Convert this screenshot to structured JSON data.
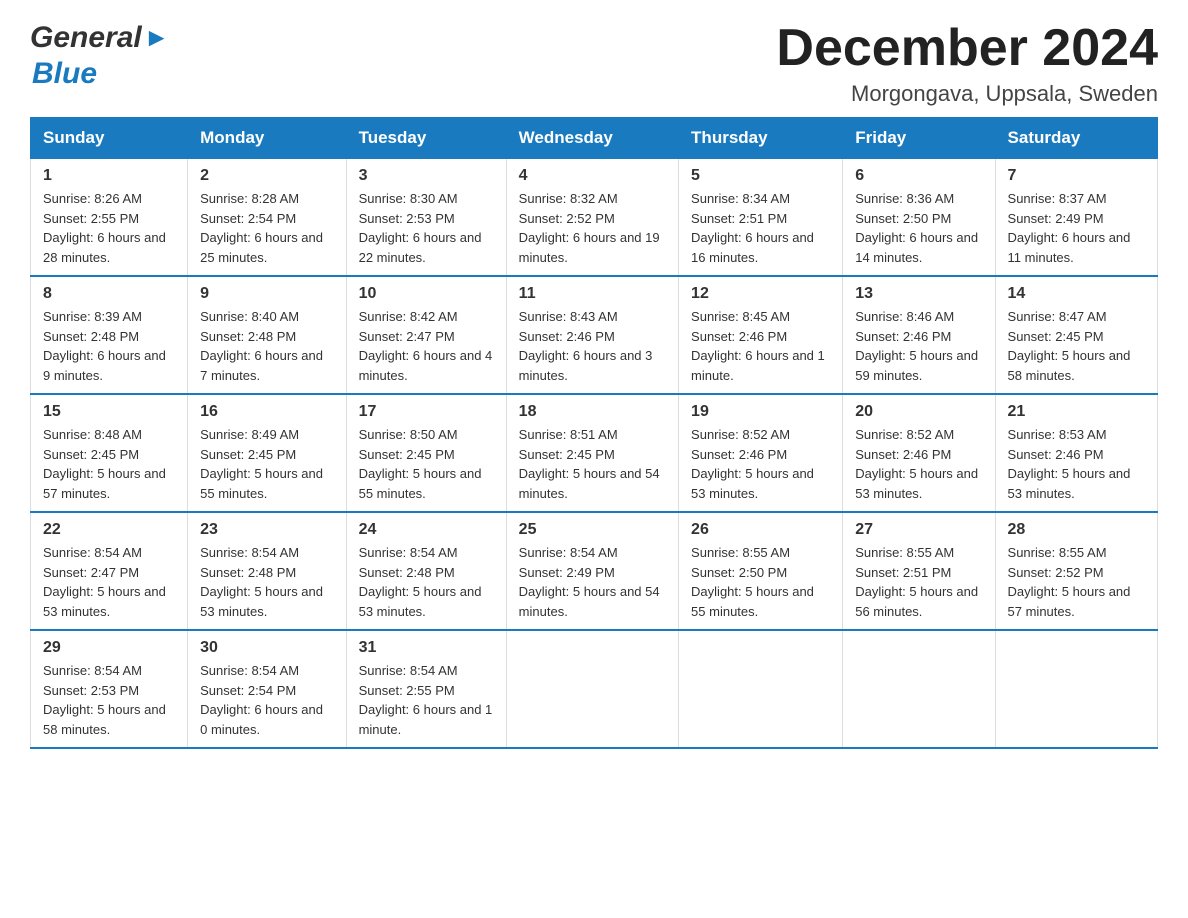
{
  "header": {
    "title": "December 2024",
    "subtitle": "Morgongava, Uppsala, Sweden"
  },
  "logo": {
    "line1": "General",
    "line2": "Blue"
  },
  "days_of_week": [
    "Sunday",
    "Monday",
    "Tuesday",
    "Wednesday",
    "Thursday",
    "Friday",
    "Saturday"
  ],
  "weeks": [
    [
      {
        "day": "1",
        "sunrise": "8:26 AM",
        "sunset": "2:55 PM",
        "daylight": "6 hours and 28 minutes."
      },
      {
        "day": "2",
        "sunrise": "8:28 AM",
        "sunset": "2:54 PM",
        "daylight": "6 hours and 25 minutes."
      },
      {
        "day": "3",
        "sunrise": "8:30 AM",
        "sunset": "2:53 PM",
        "daylight": "6 hours and 22 minutes."
      },
      {
        "day": "4",
        "sunrise": "8:32 AM",
        "sunset": "2:52 PM",
        "daylight": "6 hours and 19 minutes."
      },
      {
        "day": "5",
        "sunrise": "8:34 AM",
        "sunset": "2:51 PM",
        "daylight": "6 hours and 16 minutes."
      },
      {
        "day": "6",
        "sunrise": "8:36 AM",
        "sunset": "2:50 PM",
        "daylight": "6 hours and 14 minutes."
      },
      {
        "day": "7",
        "sunrise": "8:37 AM",
        "sunset": "2:49 PM",
        "daylight": "6 hours and 11 minutes."
      }
    ],
    [
      {
        "day": "8",
        "sunrise": "8:39 AM",
        "sunset": "2:48 PM",
        "daylight": "6 hours and 9 minutes."
      },
      {
        "day": "9",
        "sunrise": "8:40 AM",
        "sunset": "2:48 PM",
        "daylight": "6 hours and 7 minutes."
      },
      {
        "day": "10",
        "sunrise": "8:42 AM",
        "sunset": "2:47 PM",
        "daylight": "6 hours and 4 minutes."
      },
      {
        "day": "11",
        "sunrise": "8:43 AM",
        "sunset": "2:46 PM",
        "daylight": "6 hours and 3 minutes."
      },
      {
        "day": "12",
        "sunrise": "8:45 AM",
        "sunset": "2:46 PM",
        "daylight": "6 hours and 1 minute."
      },
      {
        "day": "13",
        "sunrise": "8:46 AM",
        "sunset": "2:46 PM",
        "daylight": "5 hours and 59 minutes."
      },
      {
        "day": "14",
        "sunrise": "8:47 AM",
        "sunset": "2:45 PM",
        "daylight": "5 hours and 58 minutes."
      }
    ],
    [
      {
        "day": "15",
        "sunrise": "8:48 AM",
        "sunset": "2:45 PM",
        "daylight": "5 hours and 57 minutes."
      },
      {
        "day": "16",
        "sunrise": "8:49 AM",
        "sunset": "2:45 PM",
        "daylight": "5 hours and 55 minutes."
      },
      {
        "day": "17",
        "sunrise": "8:50 AM",
        "sunset": "2:45 PM",
        "daylight": "5 hours and 55 minutes."
      },
      {
        "day": "18",
        "sunrise": "8:51 AM",
        "sunset": "2:45 PM",
        "daylight": "5 hours and 54 minutes."
      },
      {
        "day": "19",
        "sunrise": "8:52 AM",
        "sunset": "2:46 PM",
        "daylight": "5 hours and 53 minutes."
      },
      {
        "day": "20",
        "sunrise": "8:52 AM",
        "sunset": "2:46 PM",
        "daylight": "5 hours and 53 minutes."
      },
      {
        "day": "21",
        "sunrise": "8:53 AM",
        "sunset": "2:46 PM",
        "daylight": "5 hours and 53 minutes."
      }
    ],
    [
      {
        "day": "22",
        "sunrise": "8:54 AM",
        "sunset": "2:47 PM",
        "daylight": "5 hours and 53 minutes."
      },
      {
        "day": "23",
        "sunrise": "8:54 AM",
        "sunset": "2:48 PM",
        "daylight": "5 hours and 53 minutes."
      },
      {
        "day": "24",
        "sunrise": "8:54 AM",
        "sunset": "2:48 PM",
        "daylight": "5 hours and 53 minutes."
      },
      {
        "day": "25",
        "sunrise": "8:54 AM",
        "sunset": "2:49 PM",
        "daylight": "5 hours and 54 minutes."
      },
      {
        "day": "26",
        "sunrise": "8:55 AM",
        "sunset": "2:50 PM",
        "daylight": "5 hours and 55 minutes."
      },
      {
        "day": "27",
        "sunrise": "8:55 AM",
        "sunset": "2:51 PM",
        "daylight": "5 hours and 56 minutes."
      },
      {
        "day": "28",
        "sunrise": "8:55 AM",
        "sunset": "2:52 PM",
        "daylight": "5 hours and 57 minutes."
      }
    ],
    [
      {
        "day": "29",
        "sunrise": "8:54 AM",
        "sunset": "2:53 PM",
        "daylight": "5 hours and 58 minutes."
      },
      {
        "day": "30",
        "sunrise": "8:54 AM",
        "sunset": "2:54 PM",
        "daylight": "6 hours and 0 minutes."
      },
      {
        "day": "31",
        "sunrise": "8:54 AM",
        "sunset": "2:55 PM",
        "daylight": "6 hours and 1 minute."
      },
      {
        "day": "",
        "sunrise": "",
        "sunset": "",
        "daylight": ""
      },
      {
        "day": "",
        "sunrise": "",
        "sunset": "",
        "daylight": ""
      },
      {
        "day": "",
        "sunrise": "",
        "sunset": "",
        "daylight": ""
      },
      {
        "day": "",
        "sunrise": "",
        "sunset": "",
        "daylight": ""
      }
    ]
  ]
}
